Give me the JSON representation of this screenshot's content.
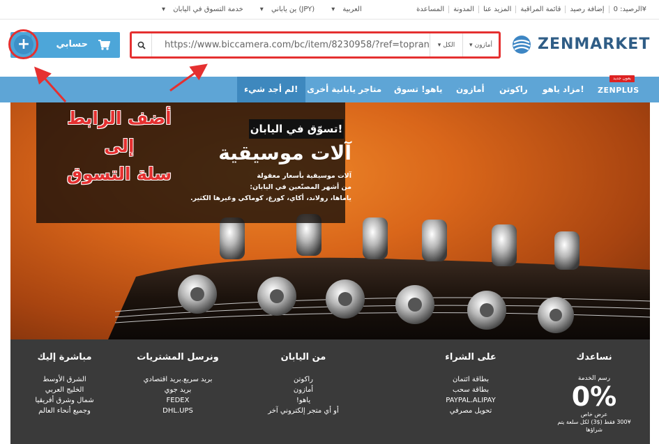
{
  "topbar": {
    "balance": "الرصيد: 0¥",
    "add_balance": "إضافة رصيد",
    "watchlist": "قائمة المراقبة",
    "more_about": "المزيد عنا",
    "blog": "المدونة",
    "help": "المساعدة",
    "language": "العربية",
    "currency": "ين ياباني (JPY)",
    "service": "خدمة التسوق في اليابان"
  },
  "header": {
    "account_label": "حسابي",
    "search": {
      "value": "https://www.biccamera.com/bc/item/8230958/?ref=topranking",
      "scope": "الكل",
      "store": "أمازون"
    },
    "logo_text": "ZENMARKET"
  },
  "nav": {
    "zenplus": "ZENPLUS",
    "new_badge": "يعون جديد",
    "items": [
      "مزاد ياهو!",
      "راكوتن",
      "أمازون",
      "ياهو! تسوق",
      "متاجر يابانية أخرى",
      "لم أجد شيء!"
    ]
  },
  "annotation": {
    "line1": "أضف الرابط إلى",
    "line2": "سلة التسوق"
  },
  "hero": {
    "tag": "تسوّق في اليابان!",
    "title": "آلات موسيقية",
    "desc1": "آلات موسيقية بأسعار معقولة",
    "desc2": "من أشهر المصنّعين في اليابان:",
    "desc3": "ياماها، رولاند، أكاي، كورغ، كوماكي وغيرها الكثير."
  },
  "footer": {
    "help": {
      "title": "نساعدك",
      "sub": "رسم الخدمة",
      "big": "0%",
      "small1": "عرض خاص",
      "small2": "300¥ فقط ($3) لكل سلعة يتم شراؤها"
    },
    "payment": {
      "title": "على الشراء",
      "items": [
        "بطاقة ائتمان",
        "بطاقة سحب",
        "PAYPAL.ALIPAY",
        "تحويل مصرفي"
      ]
    },
    "japan": {
      "title": "من اليابان",
      "items": [
        "راكوتن",
        "أمازون",
        "ياهو!",
        "أو أي متجر إلكتروني آخر"
      ]
    },
    "shipping": {
      "title": "ونرسل المشتريات",
      "items": [
        "بريد سريع.بريد اقتصادي",
        "بريد جوي",
        "FEDEX",
        "DHL.UPS"
      ]
    },
    "direct": {
      "title": "مباشرة إليك",
      "items": [
        "الشرق الأوسط",
        "الخليج العربي",
        "شمال وشرق أفريقيا",
        "وجميع أنحاء العالم"
      ]
    }
  },
  "colors": {
    "accent_blue": "#5ea5d6",
    "button_blue": "#4da6d9",
    "annotation_red": "#e53030",
    "footer_bg": "#3a3a3a"
  }
}
